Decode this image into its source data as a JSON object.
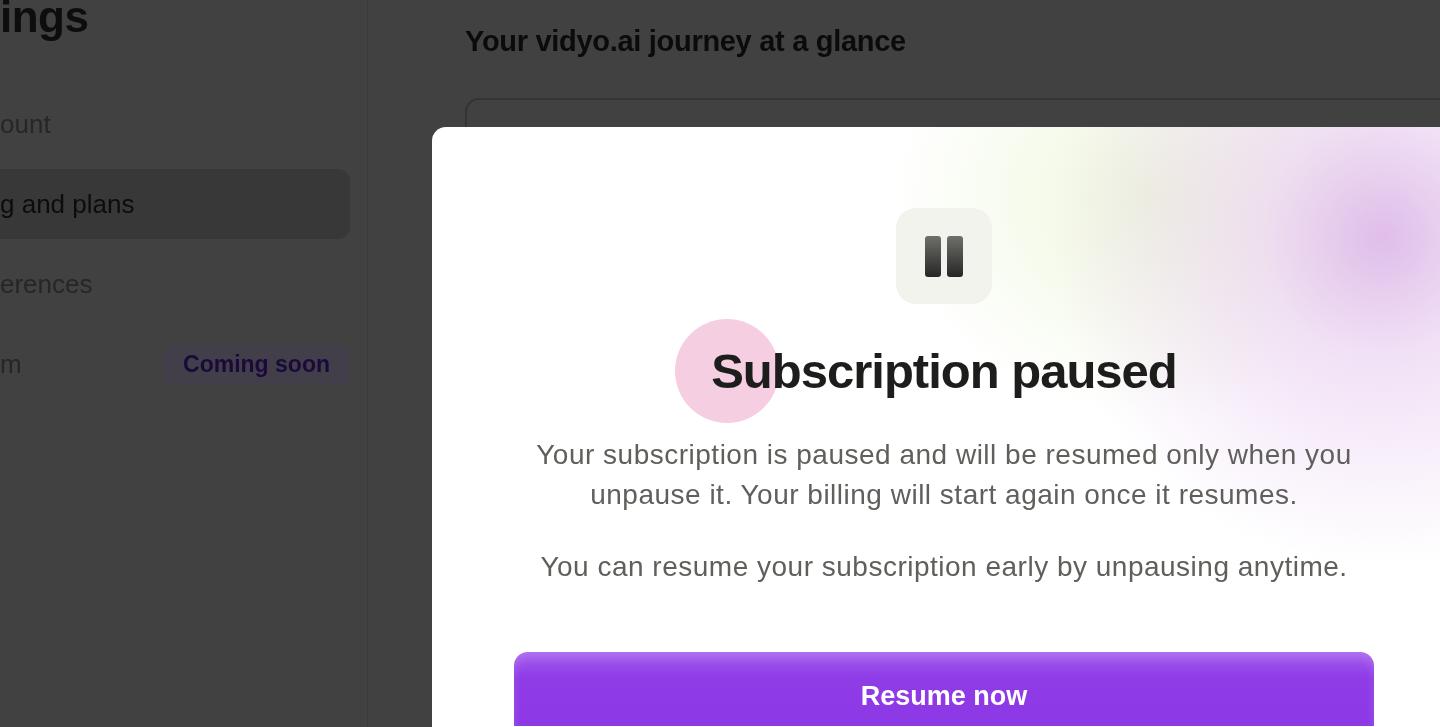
{
  "sidebar": {
    "heading": "ings",
    "items": [
      {
        "label": "ount",
        "selected": false
      },
      {
        "label": "g and plans",
        "selected": true
      },
      {
        "label": "erences",
        "selected": false
      },
      {
        "label": "m",
        "selected": false,
        "badge": "Coming soon"
      }
    ]
  },
  "main": {
    "title": "Your vidyo.ai journey at a glance"
  },
  "modal": {
    "title": "Subscription paused",
    "paragraphs": [
      "Your subscription is paused and will be resumed only when you unpause it. Your billing will start again once it resumes.",
      "You can resume your subscription early by unpausing anytime."
    ],
    "button": "Resume now"
  }
}
